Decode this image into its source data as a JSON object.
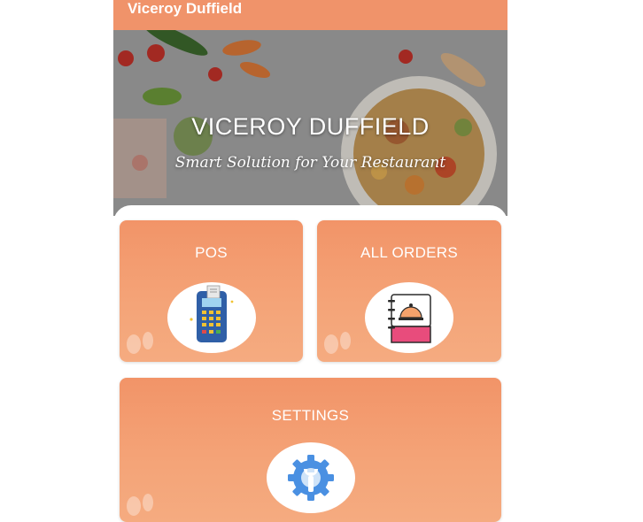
{
  "appbar": {
    "title": "Viceroy Duffield"
  },
  "hero": {
    "title": "VICEROY DUFFIELD",
    "subtitle": "Smart Solution for Your Restaurant"
  },
  "menu": {
    "pos": {
      "label": "POS",
      "icon": "card-terminal-icon"
    },
    "all_orders": {
      "label": "ALL ORDERS",
      "icon": "menu-book-cloche-icon"
    },
    "settings": {
      "label": "SETTINGS",
      "icon": "gear-wrench-icon"
    }
  },
  "colors": {
    "accent": "#f0936a",
    "card": "#f4a478"
  }
}
